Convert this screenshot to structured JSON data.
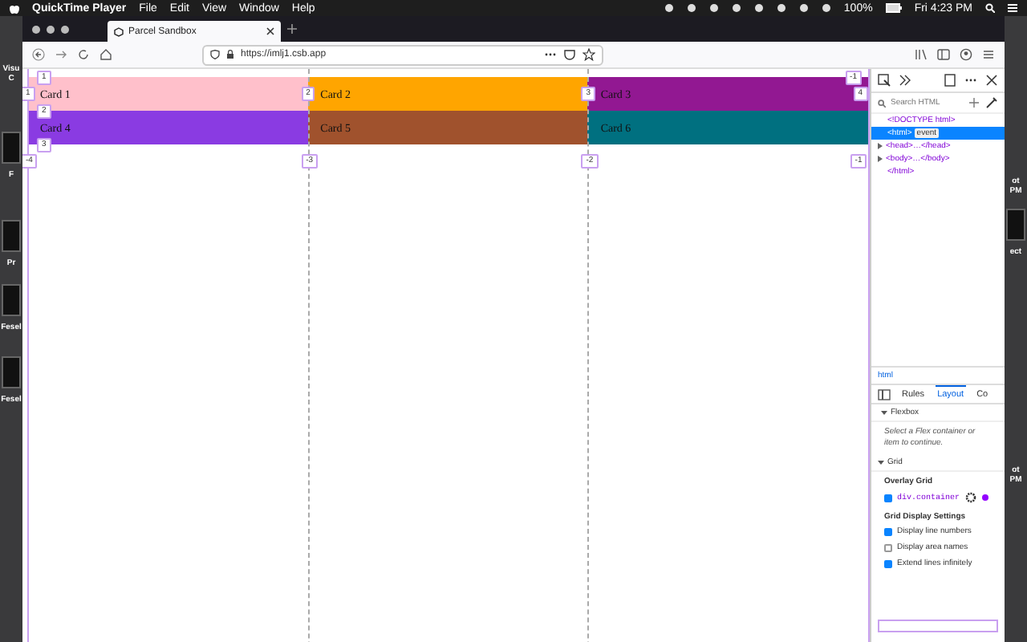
{
  "menu_bar": {
    "app": "QuickTime Player",
    "menus": [
      "File",
      "Edit",
      "View",
      "Window",
      "Help"
    ],
    "battery": "100%",
    "clock": "Fri 4:23 PM"
  },
  "desktop_left": [
    "Visu",
    "C",
    "F",
    "Pr",
    "Fesel",
    "Fesel"
  ],
  "desktop_right": [
    "ot",
    "PM",
    "ect",
    "ot",
    "PM"
  ],
  "browser": {
    "tab": "Parcel Sandbox",
    "url": "https://imlj1.csb.app"
  },
  "grid": {
    "cards": [
      {
        "label": "Card 1",
        "color": "#ffc0cb"
      },
      {
        "label": "Card 2",
        "color": "#ffa500"
      },
      {
        "label": "Card 3",
        "color": "#921892"
      },
      {
        "label": "Card 4",
        "color": "#8a3be2"
      },
      {
        "label": "Card 5",
        "color": "#a0522d"
      },
      {
        "label": "Card 6",
        "color": "#007080"
      }
    ],
    "row_numbers": [
      "1",
      "2",
      "3"
    ],
    "row_end": "-1",
    "column_numbers": [
      "1",
      "2",
      "3",
      "4"
    ],
    "column_negative": [
      "-4",
      "-3",
      "-2",
      "-1"
    ]
  },
  "devtools": {
    "search": {
      "placeholder": "Search HTML"
    },
    "tree": [
      {
        "text": "<!DOCTYPE html>",
        "selected": false,
        "collapsed": false
      },
      {
        "text": "<html>",
        "badge": "event",
        "selected": true,
        "collapsed": false
      },
      {
        "text": "<head>…</head>",
        "selected": false,
        "collapsed": true
      },
      {
        "text": "<body>…</body>",
        "selected": false,
        "collapsed": true
      },
      {
        "text": "</html>",
        "selected": false,
        "collapsed": false
      }
    ],
    "breadcrumb": "html",
    "tabs": [
      {
        "label": "Rules",
        "selected": false
      },
      {
        "label": "Layout",
        "selected": true
      },
      {
        "label": "Co",
        "selected": false
      }
    ],
    "flexbox": {
      "title": "Flexbox",
      "expanded": true,
      "message": "Select a Flex container or item to continue."
    },
    "grid": {
      "title": "Grid",
      "expanded": true,
      "overlay_title": "Overlay Grid",
      "overlay": {
        "label": "div.container",
        "checked": true,
        "color": "#9400ff"
      },
      "settings_title": "Grid Display Settings",
      "settings": [
        {
          "label": "Display line numbers",
          "checked": true
        },
        {
          "label": "Display area names",
          "checked": false
        },
        {
          "label": "Extend lines infinitely",
          "checked": true
        }
      ]
    }
  }
}
